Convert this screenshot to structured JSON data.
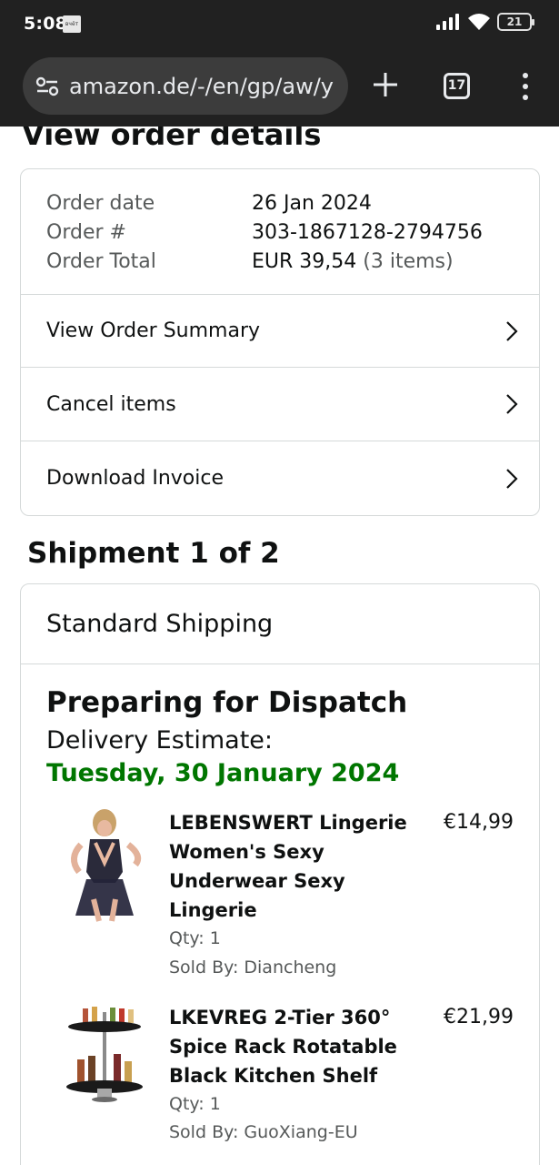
{
  "status_bar": {
    "time": "5:08",
    "notification_text": "вчёт",
    "battery": "21"
  },
  "browser": {
    "url": "amazon.de/-/en/gp/aw/y",
    "tab_count": "17"
  },
  "page": {
    "heading": "View order details",
    "order": {
      "date_label": "Order date",
      "date_value": "26 Jan 2024",
      "number_label": "Order #",
      "number_value": "303-1867128-2794756",
      "total_label": "Order Total",
      "total_value": "EUR 39,54",
      "total_items": "(3 items)"
    },
    "links": {
      "summary": "View Order Summary",
      "cancel": "Cancel items",
      "invoice": "Download Invoice"
    },
    "shipment": {
      "title": "Shipment 1 of 2",
      "method": "Standard Shipping",
      "status": "Preparing for Dispatch",
      "estimate_label": "Delivery Estimate:",
      "estimate_date": "Tuesday, 30 January 2024",
      "items": [
        {
          "title": "LEBENSWERT Lingerie Women's Sexy Underwear Sexy Lingerie",
          "price": "€14,99",
          "qty": "Qty: 1",
          "seller": "Sold By: Diancheng"
        },
        {
          "title": "LKEVREG 2-Tier 360° Spice Rack Rotatable Black Kitchen Shelf",
          "price": "€21,99",
          "qty": "Qty: 1",
          "seller": "Sold By: GuoXiang-EU"
        }
      ]
    }
  },
  "colors": {
    "chrome_bg": "#212121",
    "delivery_green": "#007600",
    "muted_text": "#565959",
    "border": "#d5d9d9"
  }
}
